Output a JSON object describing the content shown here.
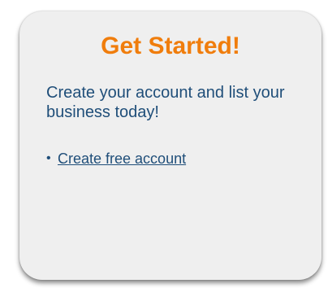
{
  "card": {
    "title": "Get Started!",
    "description": "Create your account and list your business today!",
    "links": [
      {
        "label": "Create free account"
      }
    ]
  },
  "colors": {
    "title": "#f07d0c",
    "text": "#1f4e79",
    "card_bg": "#efefef"
  }
}
